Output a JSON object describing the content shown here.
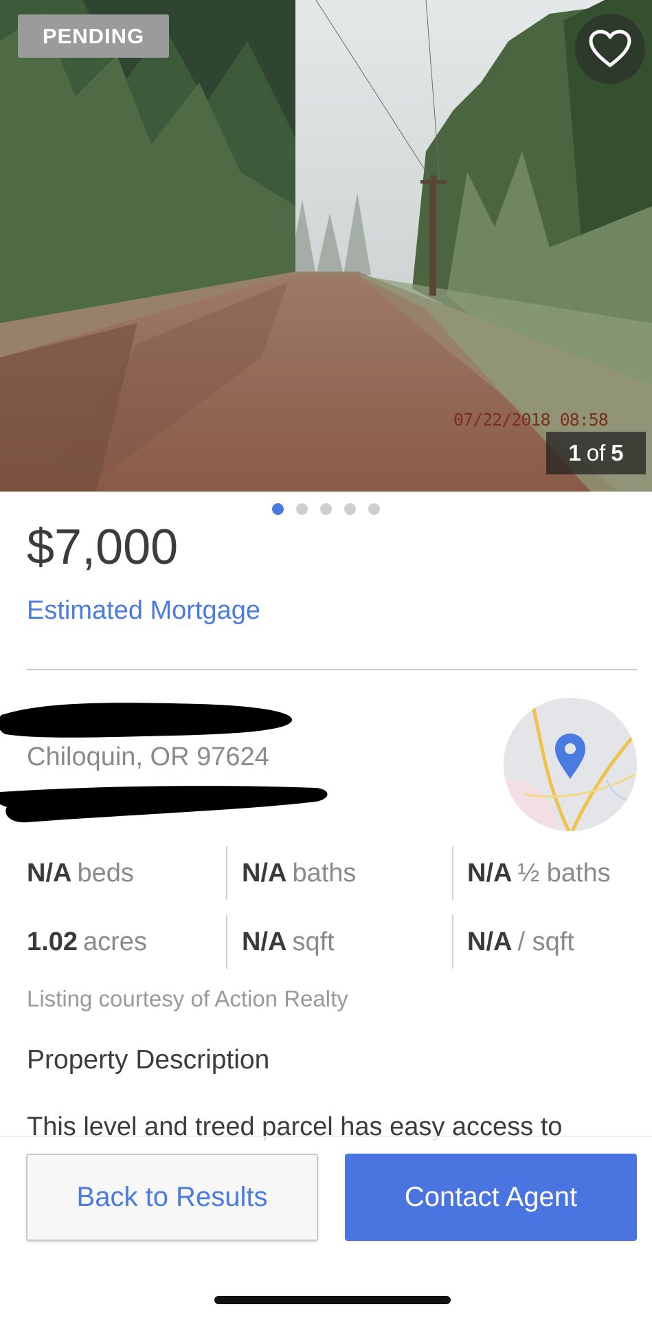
{
  "photo": {
    "status_badge": "PENDING",
    "timestamp_stamp": "07/22/2018 08:58",
    "counter_current": "1",
    "counter_of": "of",
    "counter_total": "5",
    "favorite_icon": "heart-outline-icon"
  },
  "carousel": {
    "dot_count": 5,
    "active_index": 0
  },
  "listing": {
    "price": "$7,000",
    "mortgage_link": "Estimated Mortgage",
    "city": "Chiloquin, OR 97624"
  },
  "facts": {
    "beds_value": "N/A",
    "beds_label": "beds",
    "baths_value": "N/A",
    "baths_label": "baths",
    "half_baths_value": "N/A",
    "half_baths_label": "½ baths",
    "acres_value": "1.02",
    "acres_label": "acres",
    "sqft_value": "N/A",
    "sqft_label": "sqft",
    "price_per_sqft_value": "N/A",
    "price_per_sqft_label": "/ sqft"
  },
  "courtesy": "Listing courtesy of Action Realty",
  "description": {
    "title": "Property Description",
    "text": "This level and treed parcel has easy access to"
  },
  "actions": {
    "back_label": "Back to Results",
    "contact_label": "Contact Agent"
  },
  "colors": {
    "accent": "#4a7be0",
    "badge": "#9b9b9b"
  }
}
